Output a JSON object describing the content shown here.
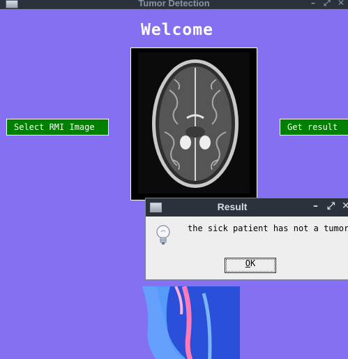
{
  "window": {
    "title": "Tumor Detection",
    "controls": {
      "minimize": "–",
      "maximize": "⤢",
      "close": "✕"
    },
    "background": "#8470f0"
  },
  "main": {
    "welcome": "Welcome",
    "select_button": "Select RMI Image",
    "result_button": "Get result",
    "button_color": "#007f00",
    "mri_image_icon": "brain-mri-scan",
    "background_image_icon": "neck-anatomy-illustration"
  },
  "dialog": {
    "title": "Result",
    "controls": {
      "minimize": "–",
      "maximize": "⤢",
      "close": "✕"
    },
    "message": "the sick patient has not a tumor!",
    "ok_mnemonic": "O",
    "ok_rest": "K",
    "icon": "lightbulb-info-icon"
  }
}
